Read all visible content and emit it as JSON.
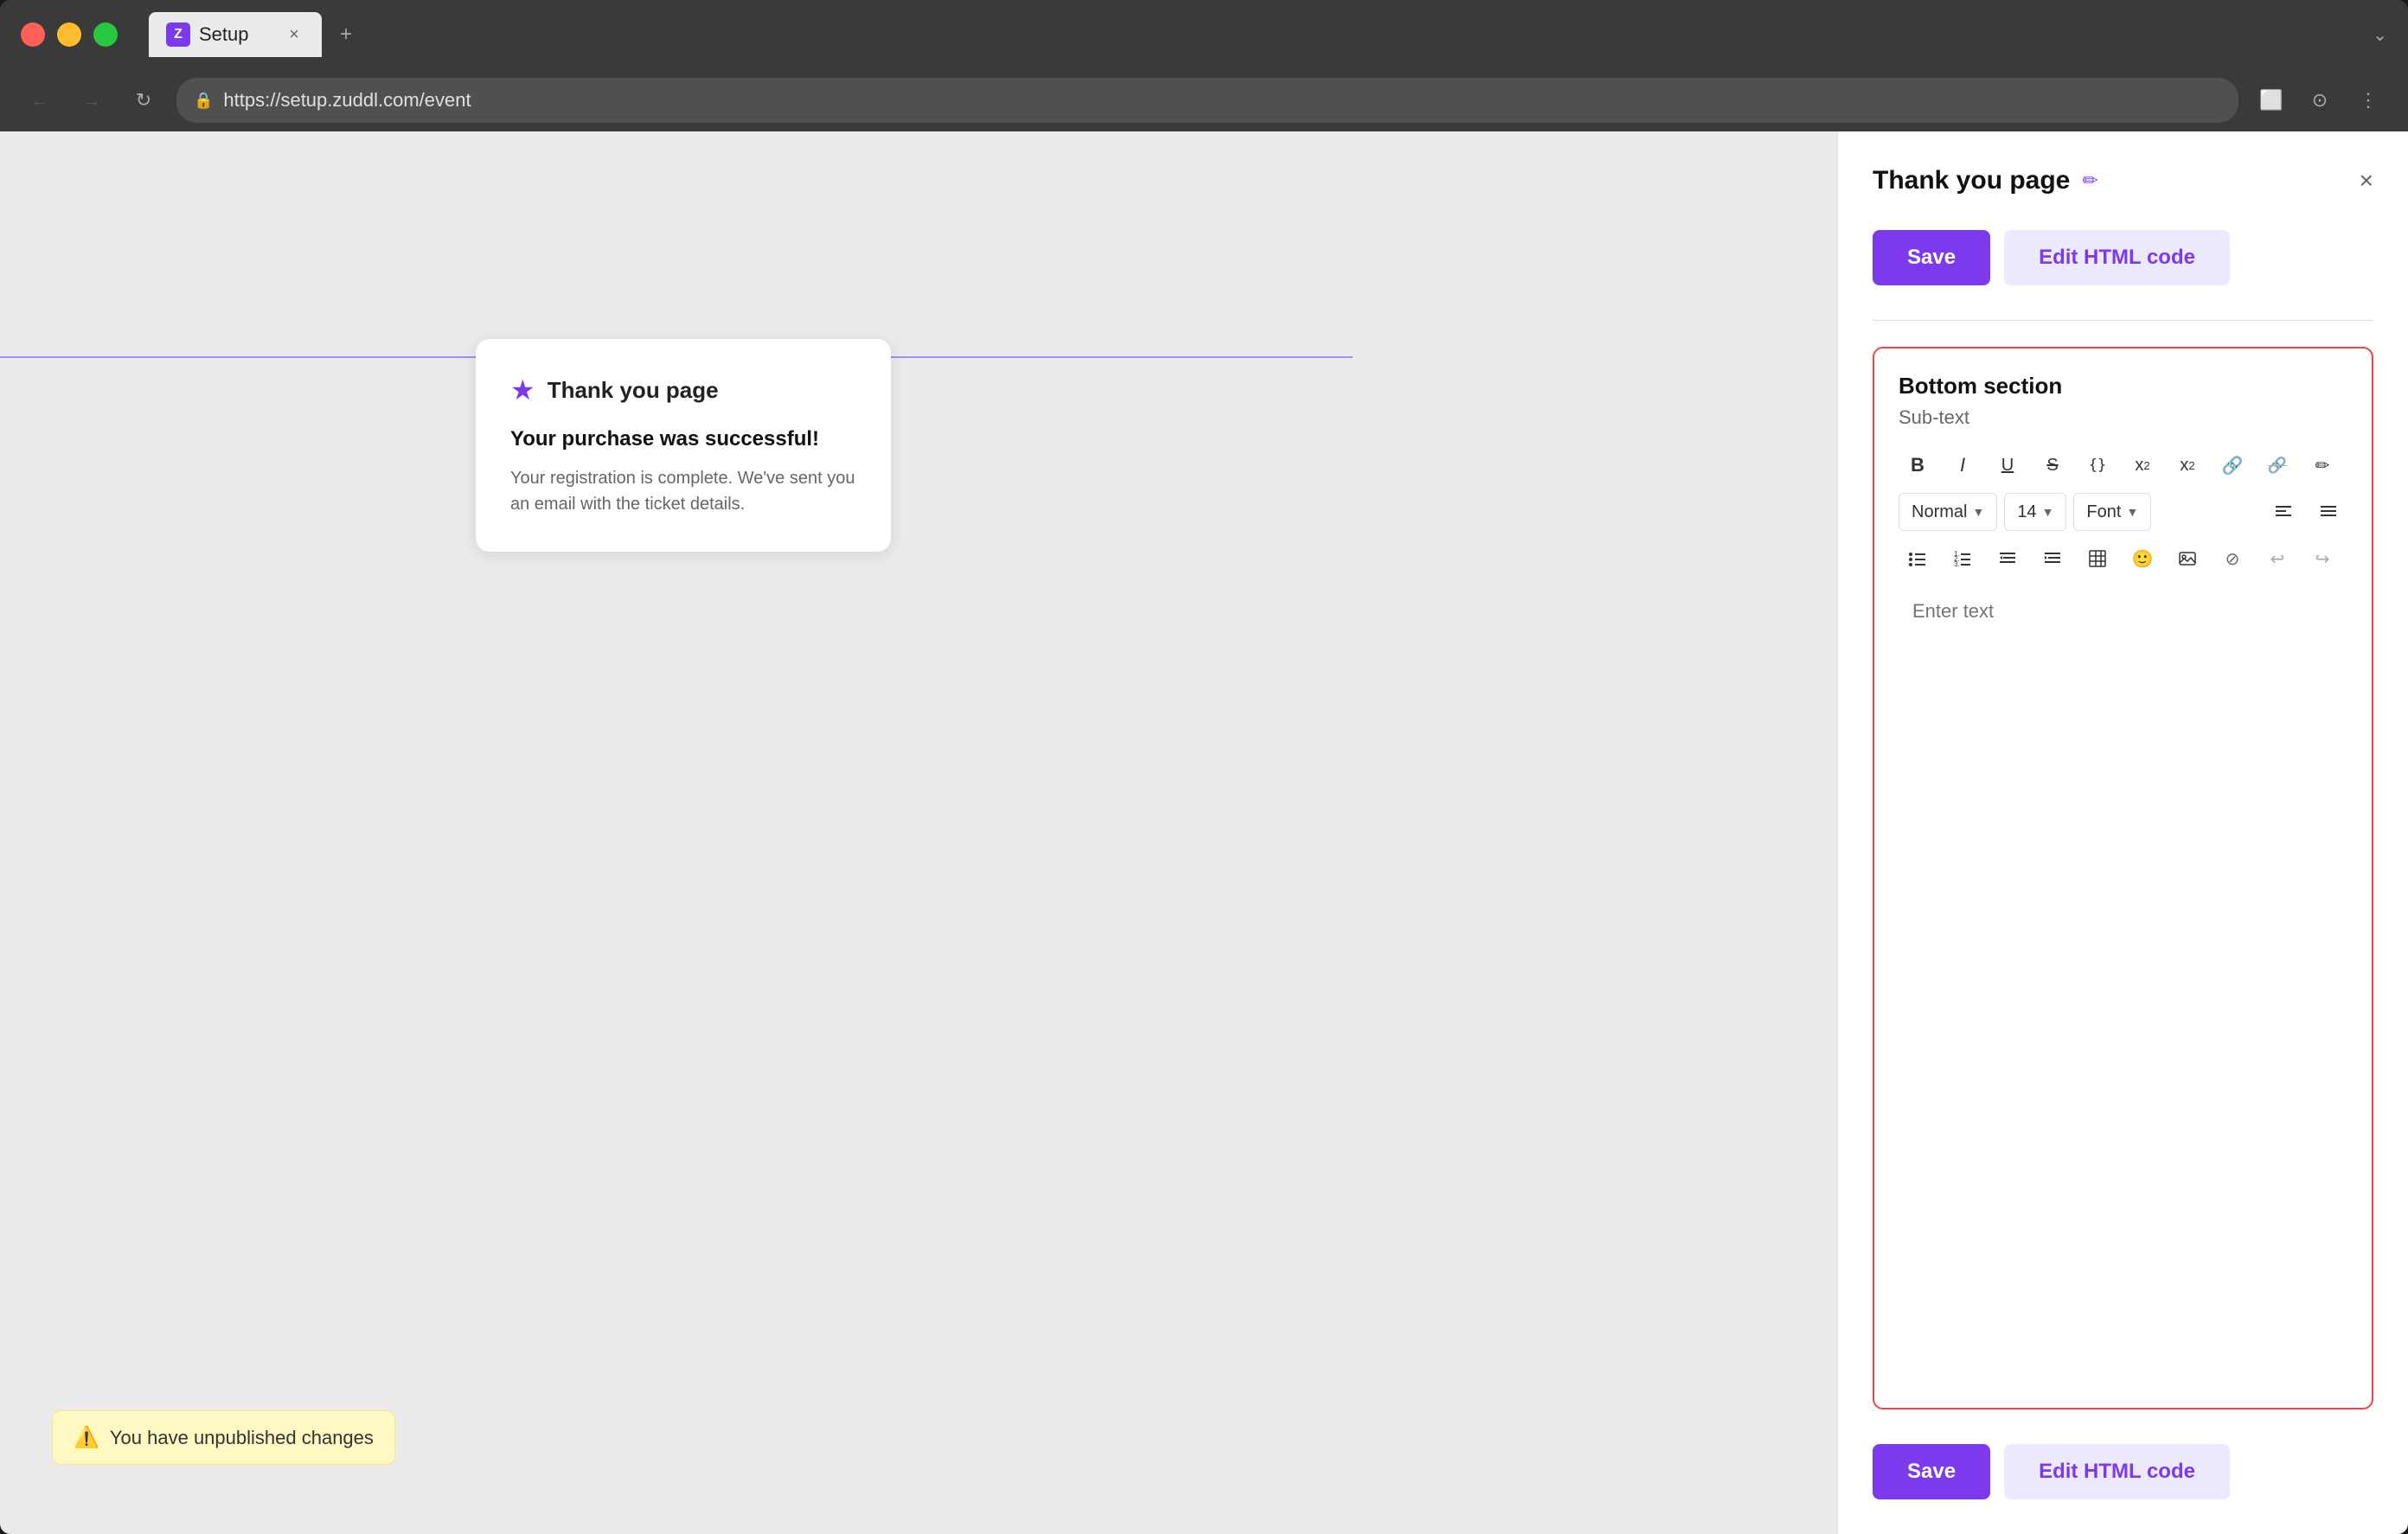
{
  "browser": {
    "tab_favicon": "Z",
    "tab_title": "Setup",
    "tab_close": "×",
    "tab_new": "+",
    "tab_dropdown": "⌄",
    "nav_back": "←",
    "nav_forward": "→",
    "nav_reload": "↻",
    "url": "https://setup.zuddl.com/event",
    "url_icon": "🔒"
  },
  "canvas": {
    "line_color": "#a78bfa"
  },
  "thankyou_card": {
    "star_icon": "★",
    "title": "Thank you page",
    "headline": "Your purchase was successful!",
    "body": "Your registration is complete. We've sent you an email with the ticket details."
  },
  "unpublished": {
    "icon": "⚠️",
    "text": "You have unpublished changes"
  },
  "panel": {
    "title": "Thank you page",
    "edit_icon": "✏",
    "close_icon": "×",
    "save_label": "Save",
    "edit_html_label": "Edit HTML code",
    "section_title": "Bottom section",
    "section_subtitle": "Sub-text",
    "text_placeholder": "Enter text",
    "toolbar": {
      "bold": "B",
      "italic": "I",
      "underline": "U",
      "strikethrough": "S",
      "code": "{}",
      "superscript": "x²",
      "subscript": "x₂",
      "link": "🔗",
      "unlink": "🚫",
      "pen": "✏",
      "normal_label": "Normal",
      "size_label": "14",
      "font_label": "Font",
      "align_left": "≡",
      "align_right": "≡",
      "bullet_list": "☰",
      "ordered_list": "☷",
      "indent_left": "⇤",
      "indent_right": "⇥",
      "table": "⊞",
      "emoji": "🙂",
      "image": "🖼",
      "eraser": "✕",
      "undo": "↩",
      "redo": "↪"
    }
  },
  "colors": {
    "purple": "#7c3aed",
    "purple_light": "#ede9fe",
    "red_border": "#ef4444",
    "warning_bg": "#fef9c3"
  }
}
